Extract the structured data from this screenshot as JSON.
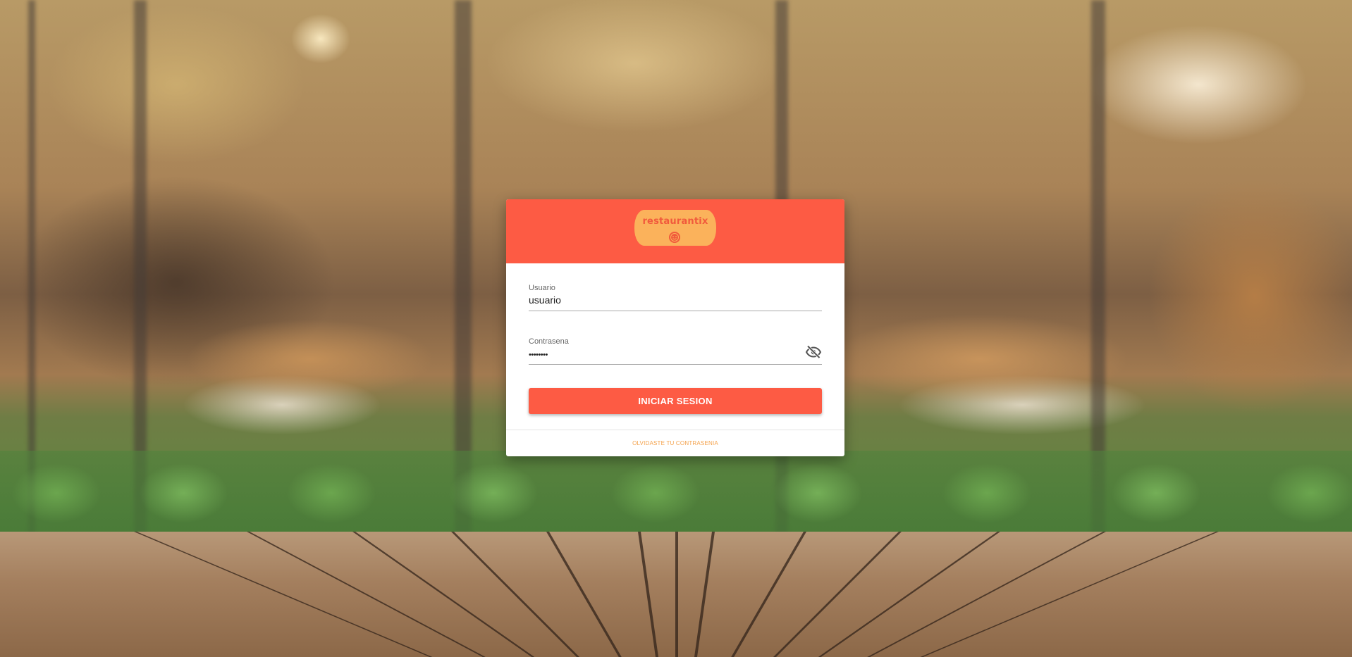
{
  "brand": {
    "name": "restaurantix",
    "logo_icon": "smiley-face-icon",
    "header_color": "#fd5b44",
    "logo_color": "#fbb25b"
  },
  "login": {
    "username_label": "Usuario",
    "username_value": "usuario",
    "password_label": "Contrasena",
    "password_value": "••••••••",
    "password_toggle_icon": "eye-off-icon",
    "submit_label": "INICIAR SESION",
    "forgot_label": "OLVIDASTE TU CONTRASENIA",
    "forgot_color": "#f4a14a"
  },
  "background": {
    "description_icon": "restaurant-background-image"
  }
}
